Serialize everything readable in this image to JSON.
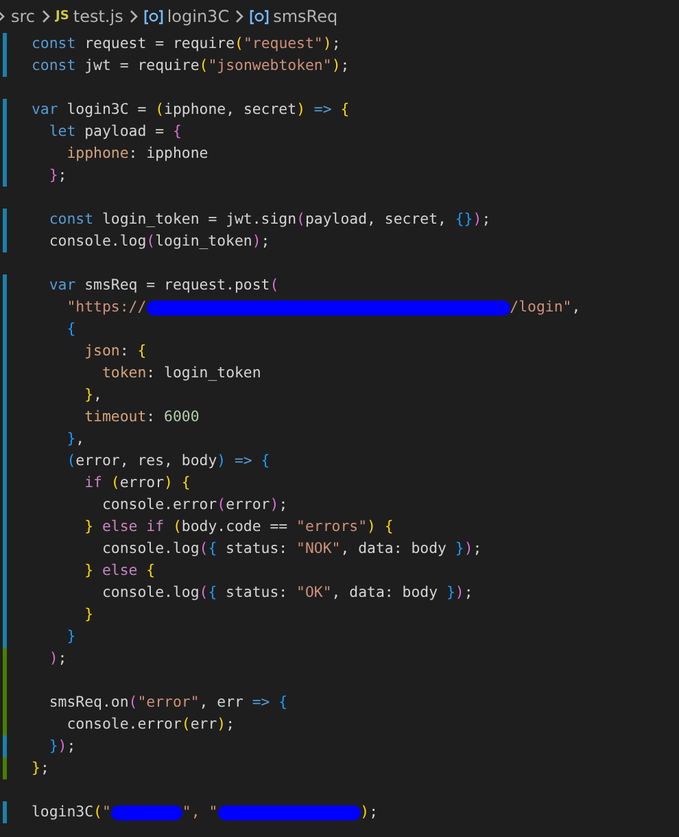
{
  "breadcrumb": [
    {
      "kind": "folder",
      "label": "src"
    },
    {
      "kind": "file",
      "icon_text": "JS",
      "label": "test.js"
    },
    {
      "kind": "symbol",
      "label": "login3C"
    },
    {
      "kind": "symbol",
      "label": "smsReq"
    }
  ],
  "lines": [
    {
      "kind": "code",
      "change": {
        "kind": "modified"
      },
      "tokens": [
        {
          "kind": "kw",
          "text": "const"
        },
        {
          "kind": "p",
          "text": " request = require"
        },
        {
          "kind": "b1",
          "text": "("
        },
        {
          "kind": "str",
          "text": "\"request\""
        },
        {
          "kind": "b1",
          "text": ")"
        },
        {
          "kind": "p",
          "text": ";"
        }
      ]
    },
    {
      "kind": "code",
      "change": {
        "kind": "modified"
      },
      "tokens": [
        {
          "kind": "kw",
          "text": "const"
        },
        {
          "kind": "p",
          "text": " jwt = require"
        },
        {
          "kind": "b1",
          "text": "("
        },
        {
          "kind": "str",
          "text": "\"jsonwebtoken\""
        },
        {
          "kind": "b1",
          "text": ")"
        },
        {
          "kind": "p",
          "text": ";"
        }
      ]
    },
    {
      "kind": "blank"
    },
    {
      "kind": "code",
      "change": {
        "kind": "modified"
      },
      "tokens": [
        {
          "kind": "kw",
          "text": "var"
        },
        {
          "kind": "p",
          "text": " login3C = "
        },
        {
          "kind": "b1",
          "text": "("
        },
        {
          "kind": "p",
          "text": "ipphone, secret"
        },
        {
          "kind": "b1",
          "text": ")"
        },
        {
          "kind": "kw",
          "text": " =>"
        },
        {
          "kind": "b1",
          "text": " {"
        }
      ],
      "children": [
        {
          "kind": "code",
          "change": {
            "kind": "modified"
          },
          "tokens": [
            {
              "kind": "kw",
              "text": "let"
            },
            {
              "kind": "p",
              "text": " payload = "
            },
            {
              "kind": "b2",
              "text": "{"
            }
          ],
          "children": [
            {
              "kind": "code",
              "change": {
                "kind": "modified"
              },
              "tokens": [
                {
                  "kind": "prop",
                  "text": "ipphone"
                },
                {
                  "kind": "p",
                  "text": ": ipphone"
                }
              ]
            }
          ]
        },
        {
          "kind": "code",
          "change": {
            "kind": "modified"
          },
          "tokens": [
            {
              "kind": "b2",
              "text": "}"
            },
            {
              "kind": "p",
              "text": ";"
            }
          ]
        },
        {
          "kind": "blank"
        },
        {
          "kind": "code",
          "change": {
            "kind": "modified"
          },
          "tokens": [
            {
              "kind": "kw",
              "text": "const"
            },
            {
              "kind": "p",
              "text": " login_token = jwt.sign"
            },
            {
              "kind": "b2",
              "text": "("
            },
            {
              "kind": "p",
              "text": "payload, secret, "
            },
            {
              "kind": "b3",
              "text": "{}"
            },
            {
              "kind": "b2",
              "text": ")"
            },
            {
              "kind": "p",
              "text": ";"
            }
          ]
        },
        {
          "kind": "code",
          "change": {
            "kind": "modified"
          },
          "tokens": [
            {
              "kind": "p",
              "text": "console.log"
            },
            {
              "kind": "b2",
              "text": "("
            },
            {
              "kind": "p",
              "text": "login_token"
            },
            {
              "kind": "b2",
              "text": ")"
            },
            {
              "kind": "p",
              "text": ";"
            }
          ]
        },
        {
          "kind": "blank"
        },
        {
          "kind": "code",
          "change": {
            "kind": "modified"
          },
          "tokens": [
            {
              "kind": "kw",
              "text": "var"
            },
            {
              "kind": "p",
              "text": " smsReq = request.post"
            },
            {
              "kind": "b2",
              "text": "("
            }
          ],
          "children": [
            {
              "kind": "code",
              "change": {
                "kind": "modified"
              },
              "tokens": [
                {
                  "kind": "str",
                  "text": "\"https://"
                },
                {
                  "kind": "redaction"
                },
                {
                  "kind": "str",
                  "text": "/login\""
                },
                {
                  "kind": "p",
                  "text": ","
                }
              ]
            },
            {
              "kind": "code",
              "change": {
                "kind": "modified"
              },
              "tokens": [
                {
                  "kind": "b3",
                  "text": "{"
                }
              ],
              "children": [
                {
                  "kind": "code",
                  "change": {
                    "kind": "modified"
                  },
                  "tokens": [
                    {
                      "kind": "prop",
                      "text": "json"
                    },
                    {
                      "kind": "p",
                      "text": ": "
                    },
                    {
                      "kind": "b1",
                      "text": "{"
                    }
                  ],
                  "children": [
                    {
                      "kind": "code",
                      "change": {
                        "kind": "modified"
                      },
                      "tokens": [
                        {
                          "kind": "prop",
                          "text": "token"
                        },
                        {
                          "kind": "p",
                          "text": ": login_token"
                        }
                      ]
                    }
                  ]
                },
                {
                  "kind": "code",
                  "change": {
                    "kind": "modified"
                  },
                  "tokens": [
                    {
                      "kind": "b1",
                      "text": "}"
                    },
                    {
                      "kind": "p",
                      "text": ","
                    }
                  ]
                },
                {
                  "kind": "code",
                  "change": {
                    "kind": "modified"
                  },
                  "tokens": [
                    {
                      "kind": "prop",
                      "text": "timeout"
                    },
                    {
                      "kind": "p",
                      "text": ": "
                    },
                    {
                      "kind": "num",
                      "text": "6000"
                    }
                  ]
                }
              ]
            },
            {
              "kind": "code",
              "change": {
                "kind": "modified"
              },
              "tokens": [
                {
                  "kind": "b3",
                  "text": "}"
                },
                {
                  "kind": "p",
                  "text": ","
                }
              ]
            },
            {
              "kind": "code",
              "change": {
                "kind": "modified"
              },
              "tokens": [
                {
                  "kind": "b3",
                  "text": "("
                },
                {
                  "kind": "p",
                  "text": "error, res, body"
                },
                {
                  "kind": "b3",
                  "text": ")"
                },
                {
                  "kind": "kw",
                  "text": " =>"
                },
                {
                  "kind": "b3",
                  "text": " {"
                }
              ],
              "children": [
                {
                  "kind": "code",
                  "change": {
                    "kind": "modified"
                  },
                  "tokens": [
                    {
                      "kind": "ctl",
                      "text": "if"
                    },
                    {
                      "kind": "b1",
                      "text": " ("
                    },
                    {
                      "kind": "p",
                      "text": "error"
                    },
                    {
                      "kind": "b1",
                      "text": ")"
                    },
                    {
                      "kind": "b1",
                      "text": " {"
                    }
                  ],
                  "children": [
                    {
                      "kind": "code",
                      "change": {
                        "kind": "modified"
                      },
                      "tokens": [
                        {
                          "kind": "p",
                          "text": "console.error"
                        },
                        {
                          "kind": "b2",
                          "text": "("
                        },
                        {
                          "kind": "p",
                          "text": "error"
                        },
                        {
                          "kind": "b2",
                          "text": ")"
                        },
                        {
                          "kind": "p",
                          "text": ";"
                        }
                      ]
                    }
                  ]
                },
                {
                  "kind": "code",
                  "change": {
                    "kind": "modified"
                  },
                  "tokens": [
                    {
                      "kind": "b1",
                      "text": "}"
                    },
                    {
                      "kind": "ctl",
                      "text": " else if"
                    },
                    {
                      "kind": "b1",
                      "text": " ("
                    },
                    {
                      "kind": "p",
                      "text": "body.code == "
                    },
                    {
                      "kind": "str",
                      "text": "\"errors\""
                    },
                    {
                      "kind": "b1",
                      "text": ")"
                    },
                    {
                      "kind": "b1",
                      "text": " {"
                    }
                  ],
                  "children": [
                    {
                      "kind": "code",
                      "change": {
                        "kind": "modified"
                      },
                      "tokens": [
                        {
                          "kind": "p",
                          "text": "console.log"
                        },
                        {
                          "kind": "b2",
                          "text": "("
                        },
                        {
                          "kind": "b3",
                          "text": "{"
                        },
                        {
                          "kind": "p",
                          "text": " status: "
                        },
                        {
                          "kind": "str",
                          "text": "\"NOK\""
                        },
                        {
                          "kind": "p",
                          "text": ", data: body "
                        },
                        {
                          "kind": "b3",
                          "text": "}"
                        },
                        {
                          "kind": "b2",
                          "text": ")"
                        },
                        {
                          "kind": "p",
                          "text": ";"
                        }
                      ]
                    }
                  ]
                },
                {
                  "kind": "code",
                  "change": {
                    "kind": "modified"
                  },
                  "tokens": [
                    {
                      "kind": "b1",
                      "text": "}"
                    },
                    {
                      "kind": "ctl",
                      "text": " else"
                    },
                    {
                      "kind": "b1",
                      "text": " {"
                    }
                  ],
                  "children": [
                    {
                      "kind": "code",
                      "change": {
                        "kind": "modified"
                      },
                      "tokens": [
                        {
                          "kind": "p",
                          "text": "console.log"
                        },
                        {
                          "kind": "b2",
                          "text": "("
                        },
                        {
                          "kind": "b3",
                          "text": "{"
                        },
                        {
                          "kind": "p",
                          "text": " status: "
                        },
                        {
                          "kind": "str",
                          "text": "\"OK\""
                        },
                        {
                          "kind": "p",
                          "text": ", data: body "
                        },
                        {
                          "kind": "b3",
                          "text": "}"
                        },
                        {
                          "kind": "b2",
                          "text": ")"
                        },
                        {
                          "kind": "p",
                          "text": ";"
                        }
                      ]
                    }
                  ]
                },
                {
                  "kind": "code",
                  "change": {
                    "kind": "modified"
                  },
                  "tokens": [
                    {
                      "kind": "b1",
                      "text": "}"
                    }
                  ]
                }
              ]
            },
            {
              "kind": "code",
              "change": {
                "kind": "modified"
              },
              "tokens": [
                {
                  "kind": "b3",
                  "text": "}"
                }
              ]
            }
          ]
        },
        {
          "kind": "code",
          "change": {
            "kind": "added"
          },
          "tokens": [
            {
              "kind": "b2",
              "text": ")"
            },
            {
              "kind": "p",
              "text": ";"
            }
          ]
        },
        {
          "kind": "blank",
          "change": {
            "kind": "added"
          }
        },
        {
          "kind": "code",
          "change": {
            "kind": "added"
          },
          "tokens": [
            {
              "kind": "p",
              "text": "smsReq.on"
            },
            {
              "kind": "b2",
              "text": "("
            },
            {
              "kind": "str",
              "text": "\"error\""
            },
            {
              "kind": "p",
              "text": ", err "
            },
            {
              "kind": "kw",
              "text": "=>"
            },
            {
              "kind": "b3",
              "text": " {"
            }
          ],
          "children": [
            {
              "kind": "code",
              "change": {
                "kind": "added"
              },
              "tokens": [
                {
                  "kind": "p",
                  "text": "console.error"
                },
                {
                  "kind": "b1",
                  "text": "("
                },
                {
                  "kind": "p",
                  "text": "err"
                },
                {
                  "kind": "b1",
                  "text": ")"
                },
                {
                  "kind": "p",
                  "text": ";"
                }
              ]
            }
          ]
        },
        {
          "kind": "code",
          "change": {
            "kind": "modified"
          },
          "tokens": [
            {
              "kind": "b3",
              "text": "}"
            },
            {
              "kind": "b2",
              "text": ")"
            },
            {
              "kind": "p",
              "text": ";"
            }
          ]
        }
      ]
    },
    {
      "kind": "code",
      "change": {
        "kind": "added"
      },
      "tokens": [
        {
          "kind": "b1",
          "text": "}"
        },
        {
          "kind": "p",
          "text": ";"
        }
      ]
    },
    {
      "kind": "blank"
    },
    {
      "kind": "code",
      "change": {
        "kind": "modified"
      },
      "tokens": [
        {
          "kind": "p",
          "text": "login3C"
        },
        {
          "kind": "b1",
          "text": "("
        },
        {
          "kind": "str",
          "text": "\""
        },
        {
          "kind": "redaction"
        },
        {
          "kind": "str",
          "text": "\", \""
        },
        {
          "kind": "redaction"
        },
        {
          "kind": "b1",
          "text": ")"
        },
        {
          "kind": "p",
          "text": ";"
        }
      ]
    }
  ]
}
